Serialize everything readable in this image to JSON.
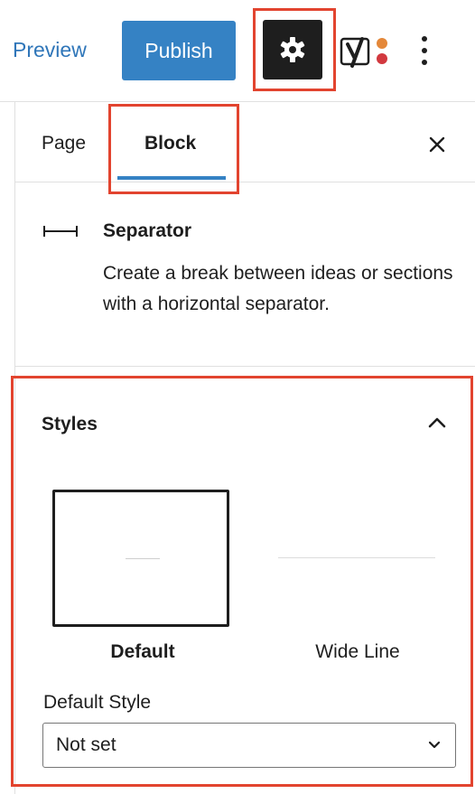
{
  "header": {
    "preview_label": "Preview",
    "publish_label": "Publish",
    "settings_icon": "gear-icon",
    "yoast_icon": "yoast-logo-icon",
    "more_icon": "vertical-ellipsis-icon"
  },
  "sidebar": {
    "tabs": [
      {
        "label": "Page",
        "active": false
      },
      {
        "label": "Block",
        "active": true
      }
    ],
    "close_icon": "close-icon",
    "block": {
      "icon": "separator-icon",
      "title": "Separator",
      "description": "Create a break between ideas or sections with a horizontal separator."
    },
    "styles": {
      "title": "Styles",
      "expanded": true,
      "options": [
        {
          "label": "Default",
          "selected": true
        },
        {
          "label": "Wide Line",
          "selected": false
        }
      ],
      "default_style_label": "Default Style",
      "default_style_value": "Not set"
    }
  },
  "colors": {
    "accent": "#3582c4",
    "highlight": "#e2442f",
    "dark": "#1e1e1e"
  }
}
